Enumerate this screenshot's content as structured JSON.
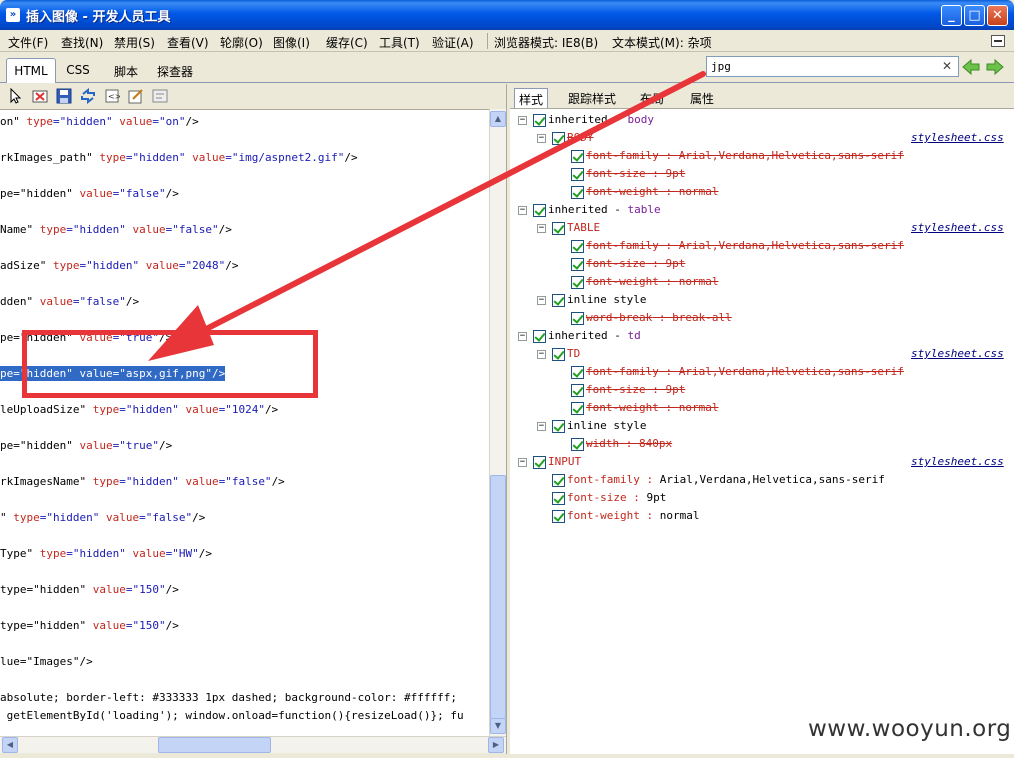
{
  "window": {
    "icon_glyph": "»",
    "title": "插入图像 - 开发人员工具",
    "min_glyph": "_",
    "max_glyph": "□",
    "close_glyph": "✕"
  },
  "menu": [
    {
      "label": "文件(F)"
    },
    {
      "label": "查找(N)"
    },
    {
      "label": "禁用(S)"
    },
    {
      "label": "查看(V)"
    },
    {
      "label": "轮廓(O)"
    },
    {
      "label": "图像(I)"
    },
    {
      "label": "缓存(C)"
    },
    {
      "label": "工具(T)"
    },
    {
      "label": "验证(A)"
    },
    {
      "label": "浏览器模式: IE8(B)"
    },
    {
      "label": "文本模式(M): 杂项"
    }
  ],
  "tabs": [
    {
      "label": "HTML"
    },
    {
      "label": "CSS"
    },
    {
      "label": "脚本"
    },
    {
      "label": "探查器"
    }
  ],
  "search": {
    "value": "jpg",
    "clear_glyph": "✕"
  },
  "style_tabs": [
    {
      "label": "样式"
    },
    {
      "label": "跟踪样式"
    },
    {
      "label": "布局"
    },
    {
      "label": "属性"
    }
  ],
  "code_lines": [
    {
      "pre": "on\" ",
      "a1": "type",
      "v1": "=\"hidden\" ",
      "a2": "value",
      "v2": "=\"on\"",
      "post": "/>"
    },
    {
      "pre": "rkImages_path\" ",
      "a1": "type",
      "v1": "=\"hidden\" ",
      "a2": "value",
      "v2": "=\"img/aspnet2.gif\"",
      "post": "/>"
    },
    {
      "pre": "pe=\"hidden\" ",
      "a1": "",
      "v1": "",
      "a2": "value",
      "v2": "=\"false\"",
      "post": "/>"
    },
    {
      "pre": "Name\" ",
      "a1": "type",
      "v1": "=\"hidden\" ",
      "a2": "value",
      "v2": "=\"false\"",
      "post": "/>"
    },
    {
      "pre": "adSize\" ",
      "a1": "type",
      "v1": "=\"hidden\" ",
      "a2": "value",
      "v2": "=\"2048\"",
      "post": "/>"
    },
    {
      "pre": "dden\" ",
      "a1": "",
      "v1": "",
      "a2": "value",
      "v2": "=\"false\"",
      "post": "/>"
    },
    {
      "pre": "pe=\"hidden\" ",
      "a1": "",
      "v1": "",
      "a2": "value",
      "v2": "=\"true\"",
      "post": "/>"
    },
    {
      "pre": "pe=\"hidden\" ",
      "a1": "",
      "v1": "",
      "a2": "value",
      "v2": "=\"aspx,gif,png\"",
      "post": "/>"
    },
    {
      "pre": "leUploadSize\" ",
      "a1": "type",
      "v1": "=\"hidden\" ",
      "a2": "value",
      "v2": "=\"1024\"",
      "post": "/>"
    },
    {
      "pre": "pe=\"hidden\" ",
      "a1": "",
      "v1": "",
      "a2": "value",
      "v2": "=\"true\"",
      "post": "/>"
    },
    {
      "pre": "rkImagesName\" ",
      "a1": "type",
      "v1": "=\"hidden\" ",
      "a2": "value",
      "v2": "=\"false\"",
      "post": "/>"
    },
    {
      "pre": "\" ",
      "a1": "type",
      "v1": "=\"hidden\" ",
      "a2": "value",
      "v2": "=\"false\"",
      "post": "/>"
    },
    {
      "pre": "Type\" ",
      "a1": "type",
      "v1": "=\"hidden\" ",
      "a2": "value",
      "v2": "=\"HW\"",
      "post": "/>"
    },
    {
      "pre": "type=\"hidden\" ",
      "a1": "",
      "v1": "",
      "a2": "value",
      "v2": "=\"150\"",
      "post": "/>"
    },
    {
      "pre": "type=\"hidden\" ",
      "a1": "",
      "v1": "",
      "a2": "value",
      "v2": "=\"150\"",
      "post": "/>"
    },
    {
      "pre": "lue=\"Images\"",
      "a1": "",
      "v1": "",
      "a2": "",
      "v2": "",
      "post": "/>"
    },
    {
      "pre": "absolute; border-left: #333333 1px dashed; background-color: #ffffff;",
      "a1": "",
      "v1": "",
      "a2": "",
      "v2": "",
      "post": ""
    },
    {
      "pre": " getElementById('loading'); window.onload=function(){resizeLoad()}; fu",
      "a1": "",
      "v1": "",
      "a2": "",
      "v2": "",
      "post": ""
    }
  ],
  "style_tree": [
    {
      "kind": "group",
      "text": "inherited",
      "tag": "body"
    },
    {
      "kind": "rule",
      "selector": "BODY",
      "source": "stylesheet.css"
    },
    {
      "kind": "decl",
      "name": "font-family",
      "value": "Arial,Verdana,Helvetica,sans-serif",
      "struck": true
    },
    {
      "kind": "decl",
      "name": "font-size",
      "value": "9pt",
      "struck": true
    },
    {
      "kind": "decl",
      "name": "font-weight",
      "value": "normal",
      "struck": true
    },
    {
      "kind": "group",
      "text": "inherited",
      "tag": "table"
    },
    {
      "kind": "rule",
      "selector": "TABLE",
      "source": "stylesheet.css"
    },
    {
      "kind": "decl",
      "name": "font-family",
      "value": "Arial,Verdana,Helvetica,sans-serif",
      "struck": true
    },
    {
      "kind": "decl",
      "name": "font-size",
      "value": "9pt",
      "struck": true
    },
    {
      "kind": "decl",
      "name": "font-weight",
      "value": "normal",
      "struck": true
    },
    {
      "kind": "rule",
      "selector": "inline style",
      "source": ""
    },
    {
      "kind": "decl",
      "name": "word-break",
      "value": "break-all",
      "struck": true
    },
    {
      "kind": "group",
      "text": "inherited",
      "tag": "td"
    },
    {
      "kind": "rule",
      "selector": "TD",
      "source": "stylesheet.css"
    },
    {
      "kind": "decl",
      "name": "font-family",
      "value": "Arial,Verdana,Helvetica,sans-serif",
      "struck": true
    },
    {
      "kind": "decl",
      "name": "font-size",
      "value": "9pt",
      "struck": true
    },
    {
      "kind": "decl",
      "name": "font-weight",
      "value": "normal",
      "struck": true
    },
    {
      "kind": "rule",
      "selector": "inline style",
      "source": ""
    },
    {
      "kind": "decl",
      "name": "width",
      "value": "840px",
      "struck": true
    },
    {
      "kind": "root",
      "selector": "INPUT",
      "source": "stylesheet.css"
    },
    {
      "kind": "decl",
      "name": "font-family",
      "value": "Arial,Verdana,Helvetica,sans-serif",
      "struck": false
    },
    {
      "kind": "decl",
      "name": "font-size",
      "value": "9pt",
      "struck": false
    },
    {
      "kind": "decl",
      "name": "font-weight",
      "value": "normal",
      "struck": false
    }
  ],
  "watermark": "www.wooyun.org",
  "annotation": {
    "color": "#e8353a"
  }
}
